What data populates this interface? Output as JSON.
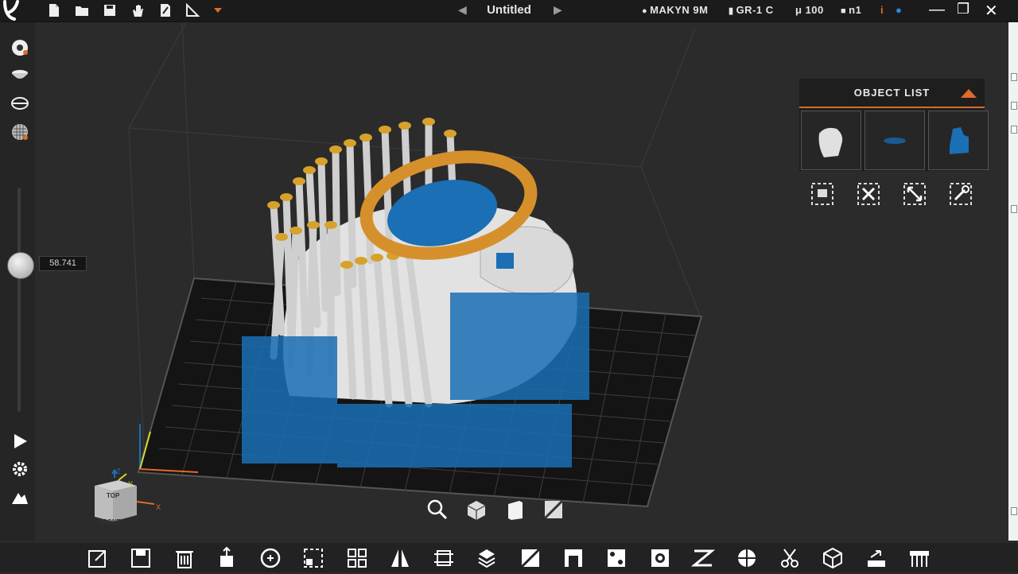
{
  "titlebar": {
    "document_title": "Untitled",
    "status": {
      "printer": "MAKYN 9M",
      "resin": "GR-1 C",
      "layer_height": "μ 100",
      "copies": "n1",
      "info_label": "i"
    }
  },
  "leftbar": {
    "slider_value": "58.741"
  },
  "object_list": {
    "title": "OBJECT LIST"
  },
  "navcube": {
    "top": "TOP",
    "front": "FRONT",
    "axis_x": "X",
    "axis_y": "Y",
    "axis_z": "Z"
  },
  "colors": {
    "accent": "#e06b2b",
    "support_blue": "#1a6fb5",
    "raft_yellow": "#d6a22b",
    "model_white": "#e8e8e8"
  }
}
